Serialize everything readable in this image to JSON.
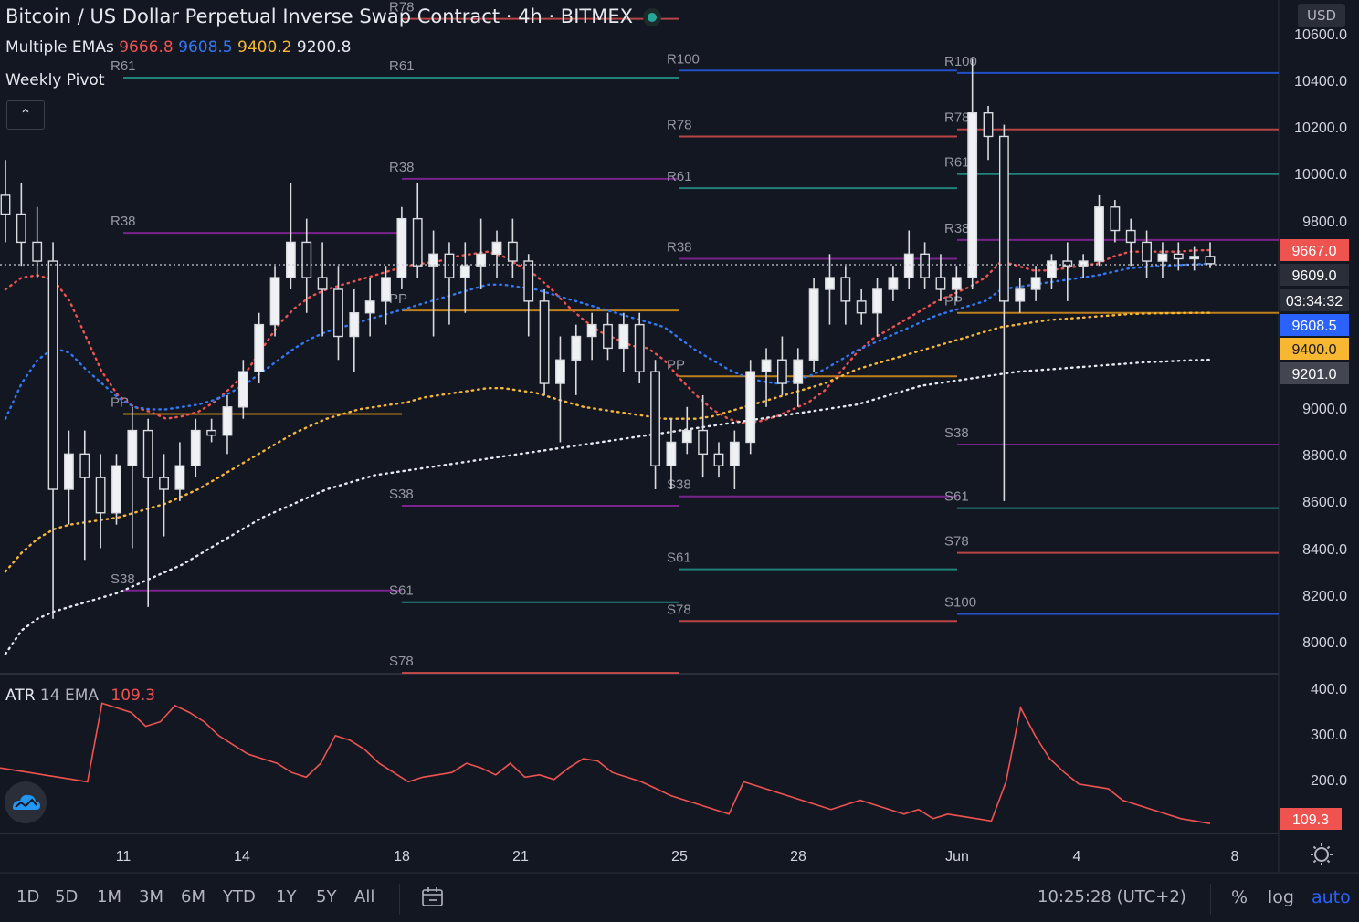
{
  "header": {
    "title": "Bitcoin / US Dollar Perpetual Inverse Swap Contract",
    "interval": "4h",
    "exchange": "BITMEX",
    "status_color": "#26a69a"
  },
  "indicators": {
    "ema": {
      "label": "Multiple EMAs",
      "values": [
        {
          "value": "9666.8",
          "color": "#ef5350"
        },
        {
          "value": "9608.5",
          "color": "#3179f5"
        },
        {
          "value": "9400.2",
          "color": "#f7b731"
        },
        {
          "value": "9200.8",
          "color": "#e6e8ee"
        }
      ]
    },
    "pivot_label": "Weekly Pivot",
    "atr": {
      "label": "ATR",
      "params": "14 EMA",
      "value": "109.3"
    }
  },
  "currency_label": "USD",
  "collapse_icon": "chevron-up-icon",
  "chart_data": {
    "type": "candlestick",
    "symbol": "XBTUSD",
    "price_axis": {
      "ticks": [
        "10600.0",
        "10400.0",
        "10200.0",
        "10000.0",
        "9800.0",
        "9000.0",
        "8800.0",
        "8600.0",
        "8400.0",
        "8200.0",
        "8000.0"
      ],
      "ylim": [
        7870,
        10730
      ]
    },
    "time_axis": {
      "ticks": [
        "11",
        "14",
        "18",
        "21",
        "25",
        "28",
        "Jun",
        "4",
        "8"
      ]
    },
    "last_price": "9609.0",
    "countdown": "03:34:32",
    "price_tags": [
      {
        "label": "9667.0",
        "color": "#ef5350"
      },
      {
        "label": "9609.0",
        "color": "#2a2e39"
      },
      {
        "label": "03:34:32",
        "color": "#2a2e39"
      },
      {
        "label": "9608.5",
        "color": "#2962ff"
      },
      {
        "label": "9400.0",
        "color": "#f7b731"
      },
      {
        "label": "9201.0",
        "color": "#434651"
      }
    ],
    "candles": [
      {
        "o": 9900,
        "h": 10050,
        "l": 9700,
        "c": 9820
      },
      {
        "o": 9820,
        "h": 9950,
        "l": 9600,
        "c": 9700
      },
      {
        "o": 9700,
        "h": 9850,
        "l": 9550,
        "c": 9620
      },
      {
        "o": 9620,
        "h": 9700,
        "l": 8100,
        "c": 8650
      },
      {
        "o": 8650,
        "h": 8900,
        "l": 8500,
        "c": 8800
      },
      {
        "o": 8800,
        "h": 8900,
        "l": 8350,
        "c": 8700
      },
      {
        "o": 8700,
        "h": 8800,
        "l": 8400,
        "c": 8550
      },
      {
        "o": 8550,
        "h": 8800,
        "l": 8500,
        "c": 8750
      },
      {
        "o": 8750,
        "h": 9000,
        "l": 8400,
        "c": 8900
      },
      {
        "o": 8900,
        "h": 8950,
        "l": 8150,
        "c": 8700
      },
      {
        "o": 8700,
        "h": 8800,
        "l": 8450,
        "c": 8650
      },
      {
        "o": 8650,
        "h": 8850,
        "l": 8600,
        "c": 8750
      },
      {
        "o": 8750,
        "h": 8950,
        "l": 8700,
        "c": 8900
      },
      {
        "o": 8900,
        "h": 8950,
        "l": 8850,
        "c": 8880
      },
      {
        "o": 8880,
        "h": 9050,
        "l": 8800,
        "c": 9000
      },
      {
        "o": 9000,
        "h": 9200,
        "l": 8950,
        "c": 9150
      },
      {
        "o": 9150,
        "h": 9400,
        "l": 9100,
        "c": 9350
      },
      {
        "o": 9350,
        "h": 9600,
        "l": 9300,
        "c": 9550
      },
      {
        "o": 9550,
        "h": 9950,
        "l": 9500,
        "c": 9700
      },
      {
        "o": 9700,
        "h": 9800,
        "l": 9400,
        "c": 9550
      },
      {
        "o": 9550,
        "h": 9700,
        "l": 9300,
        "c": 9500
      },
      {
        "o": 9500,
        "h": 9600,
        "l": 9200,
        "c": 9300
      },
      {
        "o": 9300,
        "h": 9500,
        "l": 9150,
        "c": 9400
      },
      {
        "o": 9400,
        "h": 9550,
        "l": 9300,
        "c": 9450
      },
      {
        "o": 9450,
        "h": 9600,
        "l": 9350,
        "c": 9550
      },
      {
        "o": 9550,
        "h": 9850,
        "l": 9500,
        "c": 9800
      },
      {
        "o": 9800,
        "h": 9950,
        "l": 9550,
        "c": 9600
      },
      {
        "o": 9600,
        "h": 9750,
        "l": 9300,
        "c": 9650
      },
      {
        "o": 9650,
        "h": 9700,
        "l": 9350,
        "c": 9550
      },
      {
        "o": 9550,
        "h": 9700,
        "l": 9400,
        "c": 9600
      },
      {
        "o": 9600,
        "h": 9800,
        "l": 9500,
        "c": 9650
      },
      {
        "o": 9650,
        "h": 9750,
        "l": 9550,
        "c": 9700
      },
      {
        "o": 9700,
        "h": 9800,
        "l": 9550,
        "c": 9620
      },
      {
        "o": 9620,
        "h": 9650,
        "l": 9300,
        "c": 9450
      },
      {
        "o": 9450,
        "h": 9500,
        "l": 9050,
        "c": 9100
      },
      {
        "o": 9100,
        "h": 9300,
        "l": 8850,
        "c": 9200
      },
      {
        "o": 9200,
        "h": 9350,
        "l": 9050,
        "c": 9300
      },
      {
        "o": 9300,
        "h": 9400,
        "l": 9200,
        "c": 9350
      },
      {
        "o": 9350,
        "h": 9400,
        "l": 9200,
        "c": 9250
      },
      {
        "o": 9250,
        "h": 9400,
        "l": 9150,
        "c": 9350
      },
      {
        "o": 9350,
        "h": 9400,
        "l": 9100,
        "c": 9150
      },
      {
        "o": 9150,
        "h": 9200,
        "l": 8650,
        "c": 8750
      },
      {
        "o": 8750,
        "h": 8950,
        "l": 8650,
        "c": 8850
      },
      {
        "o": 8850,
        "h": 9000,
        "l": 8800,
        "c": 8900
      },
      {
        "o": 8900,
        "h": 9050,
        "l": 8700,
        "c": 8800
      },
      {
        "o": 8800,
        "h": 8850,
        "l": 8700,
        "c": 8750
      },
      {
        "o": 8750,
        "h": 8900,
        "l": 8650,
        "c": 8850
      },
      {
        "o": 8850,
        "h": 9200,
        "l": 8800,
        "c": 9150
      },
      {
        "o": 9150,
        "h": 9250,
        "l": 9000,
        "c": 9200
      },
      {
        "o": 9200,
        "h": 9300,
        "l": 9050,
        "c": 9100
      },
      {
        "o": 9100,
        "h": 9250,
        "l": 9000,
        "c": 9200
      },
      {
        "o": 9200,
        "h": 9550,
        "l": 9150,
        "c": 9500
      },
      {
        "o": 9500,
        "h": 9650,
        "l": 9350,
        "c": 9550
      },
      {
        "o": 9550,
        "h": 9600,
        "l": 9350,
        "c": 9450
      },
      {
        "o": 9450,
        "h": 9500,
        "l": 9350,
        "c": 9400
      },
      {
        "o": 9400,
        "h": 9550,
        "l": 9300,
        "c": 9500
      },
      {
        "o": 9500,
        "h": 9600,
        "l": 9450,
        "c": 9550
      },
      {
        "o": 9550,
        "h": 9750,
        "l": 9500,
        "c": 9650
      },
      {
        "o": 9650,
        "h": 9700,
        "l": 9500,
        "c": 9550
      },
      {
        "o": 9550,
        "h": 9650,
        "l": 9450,
        "c": 9500
      },
      {
        "o": 9500,
        "h": 9600,
        "l": 9450,
        "c": 9550
      },
      {
        "o": 9550,
        "h": 10480,
        "l": 9500,
        "c": 10250
      },
      {
        "o": 10250,
        "h": 10280,
        "l": 10050,
        "c": 10150
      },
      {
        "o": 10150,
        "h": 10200,
        "l": 8600,
        "c": 9450
      },
      {
        "o": 9450,
        "h": 9550,
        "l": 9400,
        "c": 9500
      },
      {
        "o": 9500,
        "h": 9600,
        "l": 9450,
        "c": 9550
      },
      {
        "o": 9550,
        "h": 9650,
        "l": 9500,
        "c": 9620
      },
      {
        "o": 9620,
        "h": 9700,
        "l": 9450,
        "c": 9600
      },
      {
        "o": 9600,
        "h": 9650,
        "l": 9550,
        "c": 9620
      },
      {
        "o": 9620,
        "h": 9900,
        "l": 9600,
        "c": 9850
      },
      {
        "o": 9850,
        "h": 9880,
        "l": 9700,
        "c": 9750
      },
      {
        "o": 9750,
        "h": 9800,
        "l": 9600,
        "c": 9700
      },
      {
        "o": 9700,
        "h": 9750,
        "l": 9550,
        "c": 9620
      },
      {
        "o": 9620,
        "h": 9700,
        "l": 9550,
        "c": 9650
      },
      {
        "o": 9650,
        "h": 9700,
        "l": 9580,
        "c": 9630
      },
      {
        "o": 9630,
        "h": 9680,
        "l": 9580,
        "c": 9640
      },
      {
        "o": 9640,
        "h": 9700,
        "l": 9590,
        "c": 9609
      }
    ],
    "ema_series": [
      {
        "period_value": "9666.8",
        "color": "#ef5350",
        "values": [
          9500,
          9550,
          9560,
          9540,
          9450,
          9300,
          9150,
          9050,
          9000,
          8980,
          8950,
          8960,
          8980,
          9020,
          9080,
          9150,
          9250,
          9350,
          9420,
          9470,
          9500,
          9520,
          9540,
          9560,
          9580,
          9600,
          9610,
          9620,
          9640,
          9650,
          9660,
          9640,
          9600,
          9560,
          9500,
          9430,
          9370,
          9320,
          9290,
          9260,
          9250,
          9200,
          9120,
          9050,
          8990,
          8950,
          8930,
          8940,
          8960,
          8990,
          9020,
          9070,
          9150,
          9230,
          9290,
          9330,
          9370,
          9410,
          9450,
          9480,
          9510,
          9550,
          9620,
          9600,
          9580,
          9580,
          9590,
          9600,
          9610,
          9640,
          9660,
          9660,
          9660,
          9660,
          9665,
          9666.8
        ]
      },
      {
        "period_value": "9608.5",
        "color": "#3179f5",
        "values": [
          8950,
          9100,
          9200,
          9250,
          9230,
          9160,
          9100,
          9040,
          9000,
          8990,
          8990,
          9000,
          9010,
          9030,
          9060,
          9100,
          9150,
          9200,
          9250,
          9290,
          9320,
          9340,
          9360,
          9380,
          9400,
          9420,
          9440,
          9460,
          9480,
          9500,
          9520,
          9520,
          9510,
          9500,
          9480,
          9460,
          9440,
          9420,
          9400,
          9380,
          9360,
          9340,
          9290,
          9240,
          9200,
          9160,
          9130,
          9110,
          9100,
          9110,
          9130,
          9160,
          9200,
          9240,
          9270,
          9300,
          9330,
          9360,
          9390,
          9410,
          9430,
          9450,
          9500,
          9510,
          9520,
          9530,
          9540,
          9550,
          9560,
          9575,
          9590,
          9595,
          9600,
          9603,
          9606,
          9608.5
        ]
      },
      {
        "period_value": "9400.2",
        "color": "#f7b731",
        "values": [
          8300,
          8380,
          8440,
          8480,
          8500,
          8510,
          8520,
          8530,
          8550,
          8570,
          8590,
          8620,
          8650,
          8690,
          8730,
          8770,
          8810,
          8850,
          8890,
          8920,
          8950,
          8970,
          8990,
          9000,
          9010,
          9020,
          9040,
          9050,
          9060,
          9070,
          9080,
          9080,
          9070,
          9060,
          9040,
          9020,
          9000,
          8990,
          8980,
          8970,
          8960,
          8950,
          8950,
          8950,
          8960,
          8980,
          9000,
          9020,
          9040,
          9060,
          9080,
          9100,
          9130,
          9160,
          9180,
          9200,
          9220,
          9240,
          9260,
          9280,
          9300,
          9320,
          9340,
          9350,
          9360,
          9370,
          9375,
          9380,
          9385,
          9390,
          9395,
          9397,
          9398,
          9399,
          9400,
          9400.2
        ]
      },
      {
        "period_value": "9200.8",
        "color": "#e6e8ee",
        "values": [
          7950,
          8050,
          8100,
          8130,
          8150,
          8170,
          8190,
          8210,
          8240,
          8270,
          8300,
          8330,
          8370,
          8410,
          8450,
          8490,
          8530,
          8560,
          8590,
          8620,
          8650,
          8670,
          8690,
          8710,
          8720,
          8730,
          8740,
          8750,
          8760,
          8770,
          8780,
          8790,
          8800,
          8810,
          8820,
          8830,
          8840,
          8850,
          8860,
          8870,
          8880,
          8890,
          8900,
          8910,
          8920,
          8930,
          8940,
          8950,
          8960,
          8970,
          8980,
          8990,
          9000,
          9010,
          9030,
          9050,
          9070,
          9090,
          9100,
          9110,
          9120,
          9130,
          9140,
          9150,
          9155,
          9160,
          9165,
          9170,
          9175,
          9180,
          9185,
          9190,
          9193,
          9196,
          9199,
          9200.8
        ]
      }
    ],
    "pivots": [
      {
        "period": "wk1",
        "levels": [
          {
            "label": "R61",
            "value": 10400
          },
          {
            "label": "R38",
            "value": 9740
          },
          {
            "label": "PP",
            "value": 8970
          },
          {
            "label": "S38",
            "value": 8220
          }
        ]
      },
      {
        "period": "wk2",
        "levels": [
          {
            "label": "R78",
            "value": 10650
          },
          {
            "label": "R61",
            "value": 10400
          },
          {
            "label": "R38",
            "value": 9970
          },
          {
            "label": "PP",
            "value": 9410
          },
          {
            "label": "S38",
            "value": 8580
          },
          {
            "label": "S61",
            "value": 8170
          },
          {
            "label": "S78",
            "value": 7870
          }
        ]
      },
      {
        "period": "wk3",
        "levels": [
          {
            "label": "R100",
            "value": 10430
          },
          {
            "label": "R78",
            "value": 10150
          },
          {
            "label": "R61",
            "value": 9930
          },
          {
            "label": "R38",
            "value": 9630
          },
          {
            "label": "PP",
            "value": 9130
          },
          {
            "label": "S38",
            "value": 8620
          },
          {
            "label": "S61",
            "value": 8310
          },
          {
            "label": "S78",
            "value": 8090
          },
          {
            "label": "S100",
            "value": 7800
          }
        ]
      },
      {
        "period": "wk4",
        "levels": [
          {
            "label": "R100",
            "value": 10420
          },
          {
            "label": "R78",
            "value": 10180
          },
          {
            "label": "R61",
            "value": 9990
          },
          {
            "label": "R38",
            "value": 9710
          },
          {
            "label": "PP",
            "value": 9400
          },
          {
            "label": "S38",
            "value": 8840
          },
          {
            "label": "S61",
            "value": 8570
          },
          {
            "label": "S78",
            "value": 8380
          },
          {
            "label": "S100",
            "value": 8120
          }
        ]
      }
    ],
    "pivot_colors": {
      "R100": "#2962ff",
      "S100": "#2962ff",
      "R78": "#ef5350",
      "S78": "#ef5350",
      "R61": "#26a69a",
      "S61": "#26a69a",
      "R38": "#9c27b0",
      "S38": "#9c27b0",
      "PP": "#f7a21b"
    },
    "atr": {
      "axis_ticks": [
        "400.0",
        "300.0",
        "200.0"
      ],
      "ylim": [
        90,
        430
      ],
      "current": "109.3",
      "values": [
        230,
        225,
        220,
        215,
        210,
        205,
        200,
        370,
        360,
        350,
        320,
        330,
        365,
        350,
        330,
        300,
        280,
        260,
        250,
        240,
        220,
        210,
        240,
        300,
        290,
        270,
        240,
        220,
        200,
        210,
        215,
        220,
        240,
        230,
        215,
        240,
        210,
        215,
        205,
        230,
        250,
        245,
        220,
        210,
        200,
        185,
        170,
        160,
        150,
        140,
        130,
        200,
        190,
        180,
        170,
        160,
        150,
        140,
        150,
        160,
        150,
        140,
        130,
        140,
        120,
        130,
        125,
        120,
        115,
        200,
        360,
        300,
        250,
        220,
        195,
        190,
        185,
        160,
        150,
        140,
        130,
        120,
        115,
        109.3
      ]
    }
  },
  "toolbar": {
    "timeframes": [
      "1D",
      "5D",
      "1M",
      "3M",
      "6M",
      "YTD",
      "1Y",
      "5Y",
      "All"
    ],
    "clock": "10:25:28 (UTC+2)",
    "percent": "%",
    "log": "log",
    "auto": "auto"
  }
}
